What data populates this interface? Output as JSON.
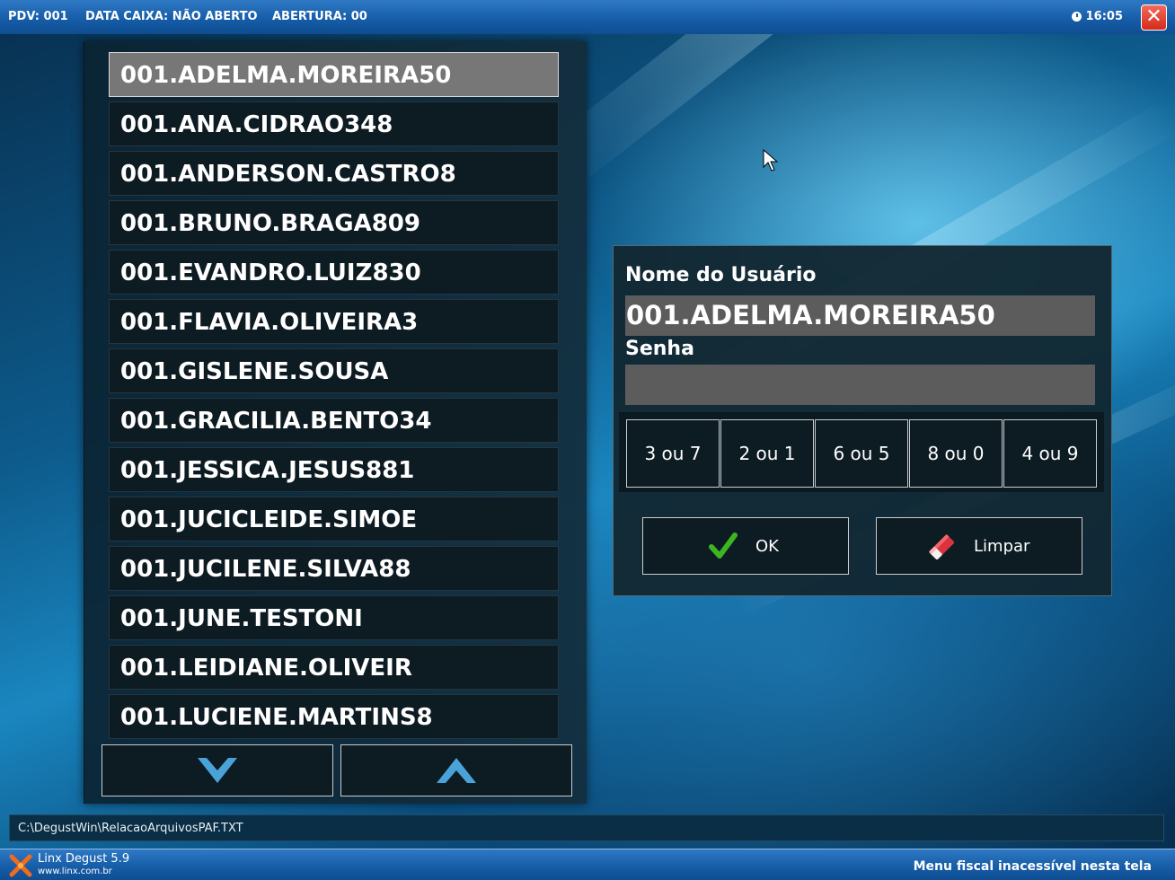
{
  "header": {
    "pdv": "PDV: 001",
    "data_caixa": "DATA CAIXA: NÃO ABERTO",
    "abertura": "ABERTURA: 00",
    "time": "16:05",
    "clock_icon": "clock-icon",
    "close_icon": "close-icon",
    "close_glyph": "✕"
  },
  "users": [
    "001.ADELMA.MOREIRA50",
    "001.ANA.CIDRAO348",
    "001.ANDERSON.CASTRO8",
    "001.BRUNO.BRAGA809",
    "001.EVANDRO.LUIZ830",
    "001.FLAVIA.OLIVEIRA3",
    "001.GISLENE.SOUSA",
    "001.GRACILIA.BENTO34",
    "001.JESSICA.JESUS881",
    "001.JUCICLEIDE.SIMOE",
    "001.JUCILENE.SILVA88",
    "001.JUNE.TESTONI",
    "001.LEIDIANE.OLIVEIR",
    "001.LUCIENE.MARTINS8"
  ],
  "selected_user": "001.ADELMA.MOREIRA50",
  "scroll": {
    "down_icon": "chevron-down-icon",
    "up_icon": "chevron-up-icon"
  },
  "login": {
    "user_label": "Nome do Usuário",
    "user_value": "001.ADELMA.MOREIRA50",
    "password_label": "Senha",
    "password_value": "",
    "keypad": [
      "3 ou 7",
      "2 ou 1",
      "6 ou 5",
      "8 ou 0",
      "4 ou 9"
    ],
    "ok_label": "OK",
    "ok_icon": "checkmark-icon",
    "clear_label": "Limpar",
    "clear_icon": "eraser-icon"
  },
  "status_path": "C:\\DegustWin\\RelacaoArquivosPAF.TXT",
  "footer": {
    "brand": "Linx Degust 5.9",
    "url": "www.linx.com.br",
    "fiscal_msg": "Menu fiscal inacessível nesta tela"
  },
  "colors": {
    "accent_blue": "#155ba6",
    "selected_row": "#777777",
    "check_green": "#3cb521",
    "close_red": "#d42a1a"
  }
}
